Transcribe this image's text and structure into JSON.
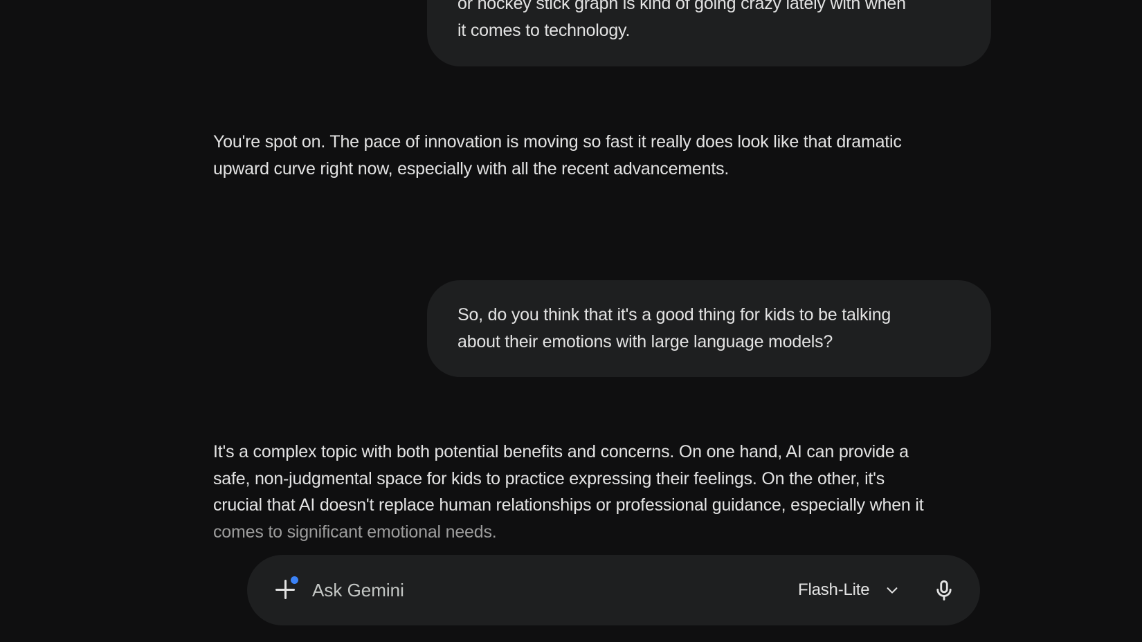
{
  "conversation": {
    "user_message_1": {
      "lines": [
        "or hockey stick graph is kind of going crazy lately with when",
        "it comes to technology."
      ]
    },
    "model_response_1": {
      "lines": [
        "You're spot on. The pace of innovation is moving so fast it really does look like that dramatic",
        "upward curve right now, especially with all the recent advancements."
      ]
    },
    "user_message_2": {
      "lines": [
        "So, do you think that it's a good thing for kids to be talking",
        "about their emotions with large language models?"
      ]
    },
    "model_response_2": {
      "lines": [
        "It's a complex topic with both potential benefits and concerns. On one hand, AI can provide a",
        "safe, non-judgmental space for kids to practice expressing their feelings. On the other, it's",
        "crucial that AI doesn't replace human relationships or professional guidance, especially when it",
        "comes to significant emotional needs."
      ]
    }
  },
  "input_bar": {
    "placeholder": "Ask Gemini",
    "value": "",
    "model_selector_label": "Flash-Lite",
    "icons": {
      "add": "plus-icon",
      "notification": "blue-dot-indicator",
      "dropdown": "chevron-down-icon",
      "voice": "microphone-icon"
    }
  },
  "colors": {
    "background": "#0f0f10",
    "bubble": "#1e1f20",
    "text": "#e3e3e3",
    "accent_dot": "#3b82f6"
  }
}
